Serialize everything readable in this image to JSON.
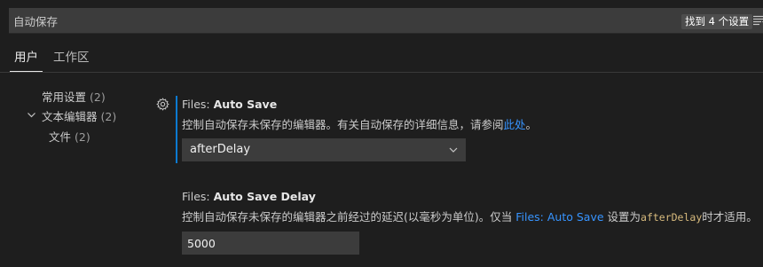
{
  "search": {
    "value": "自动保存",
    "result_count": "找到 4 个设置"
  },
  "tabs": [
    {
      "label": "用户",
      "active": true
    },
    {
      "label": "工作区",
      "active": false
    }
  ],
  "toc": [
    {
      "label": "常用设置",
      "count": "(2)"
    },
    {
      "label": "文本编辑器",
      "count": "(2)",
      "expanded": true
    },
    {
      "label": "文件",
      "count": "(2)"
    }
  ],
  "settings": [
    {
      "category": "Files: ",
      "name": "Auto Save",
      "desc_prefix": "控制自动保存未保存的编辑器。有关自动保存的详细信息，请参阅",
      "desc_link": "此处",
      "desc_suffix": "。",
      "value": "afterDelay"
    },
    {
      "category": "Files: ",
      "name": "Auto Save Delay",
      "desc_prefix": "控制自动保存未保存的编辑器之前经过的延迟(以毫秒为单位)。仅当 ",
      "desc_link": "Files: Auto Save",
      "desc_mid": " 设置为",
      "desc_code": "afterDelay",
      "desc_suffix": "时才适用。",
      "value": "5000"
    }
  ],
  "colors": {
    "accent": "#0c7ad1",
    "link": "#3794ff",
    "code": "#d7ba7d",
    "background": "#1e1e1e"
  },
  "icons": [
    "filter-icon",
    "chevron-down-icon",
    "gear-icon"
  ]
}
